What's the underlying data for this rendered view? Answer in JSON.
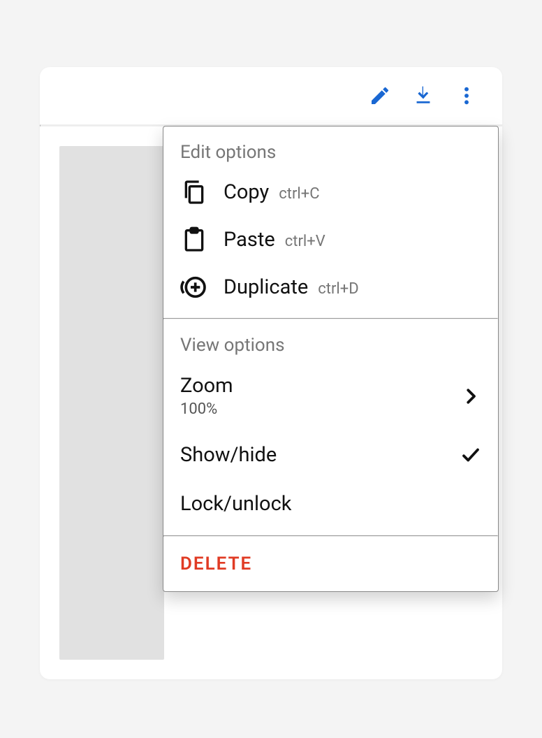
{
  "toolbar": {
    "edit_icon": "pencil",
    "download_icon": "download",
    "more_icon": "more-vert"
  },
  "menu": {
    "edit_section": {
      "label": "Edit options",
      "copy": {
        "label": "Copy",
        "shortcut": "ctrl+C"
      },
      "paste": {
        "label": "Paste",
        "shortcut": "ctrl+V"
      },
      "duplicate": {
        "label": "Duplicate",
        "shortcut": "ctrl+D"
      }
    },
    "view_section": {
      "label": "View options",
      "zoom": {
        "label": "Zoom",
        "secondary": "100%"
      },
      "showhide": {
        "label": "Show/hide",
        "checked": true
      },
      "lockunlock": {
        "label": "Lock/unlock"
      }
    },
    "delete": {
      "label": "DELETE"
    }
  },
  "colors": {
    "accent": "#1967d2",
    "danger": "#e03b24"
  }
}
